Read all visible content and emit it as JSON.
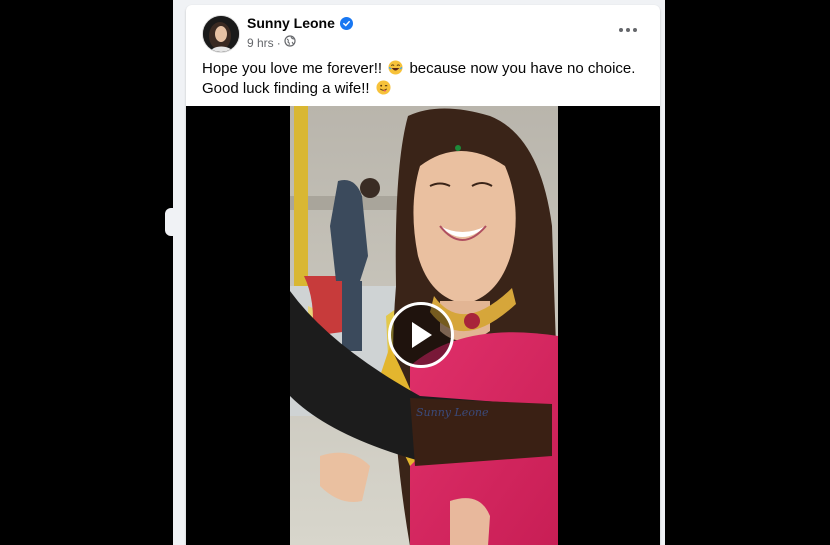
{
  "post": {
    "author": "Sunny Leone",
    "time": "9 hrs",
    "caption_line1": "Hope you love me forever!!",
    "caption_line1_after": "because now you have no choice.",
    "caption_line2": "Good luck finding a wife!!",
    "emoji_1": "laughing-face",
    "emoji_2": "winking-tongue-face"
  },
  "video": {
    "tattoo_text": "Sunny Leone"
  },
  "colors": {
    "verified": "#1877f2",
    "secondary_text": "#65676b",
    "page_background": "#f0f2f5"
  }
}
